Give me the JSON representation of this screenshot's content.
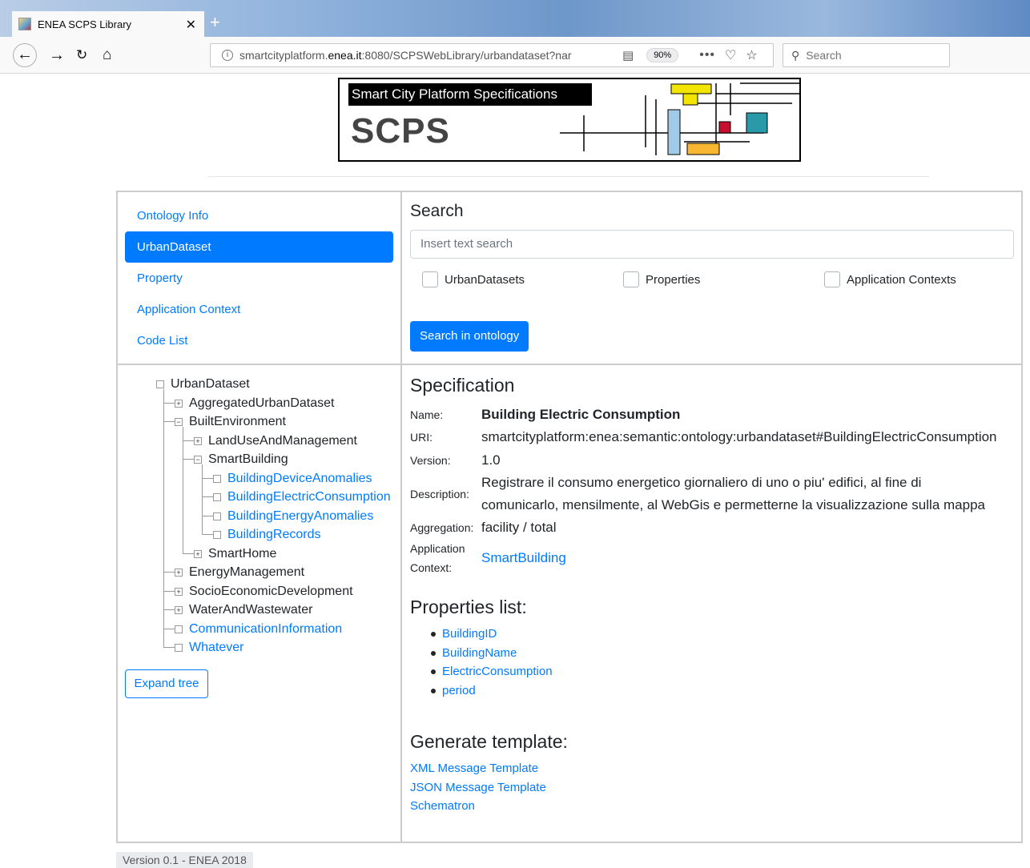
{
  "browser": {
    "tab_title": "ENEA SCPS Library",
    "url_plain": "smartcityplatform.",
    "url_bold": "enea.it",
    "url_rest": ":8080/SCPSWebLibrary/urbandataset?nar",
    "zoom": "90%",
    "search_placeholder": "Search",
    "icons": [
      "back-icon",
      "forward-icon",
      "reload-icon",
      "home-icon",
      "info-icon",
      "reader-icon",
      "more-icon",
      "pocket-icon",
      "star-icon",
      "search-icon",
      "close-icon",
      "new-tab-icon"
    ]
  },
  "logo": {
    "banner": "Smart City Platform Specifications",
    "acronym": "SCPS",
    "colors": {
      "yellow": "#f2e500",
      "blue": "#9fcbe8",
      "orange": "#f7b733",
      "red": "#c8102e",
      "teal": "#2a9aa8"
    }
  },
  "nav": {
    "items": [
      {
        "label": "Ontology Info",
        "active": false
      },
      {
        "label": "UrbanDataset",
        "active": true
      },
      {
        "label": "Property",
        "active": false
      },
      {
        "label": "Application Context",
        "active": false
      },
      {
        "label": "Code List",
        "active": false
      }
    ]
  },
  "search": {
    "title": "Search",
    "placeholder": "Insert text search",
    "checkboxes": [
      "UrbanDatasets",
      "Properties",
      "Application Contexts"
    ],
    "button": "Search in ontology"
  },
  "tree": {
    "nodes": [
      {
        "label": "UrbanDataset",
        "state": "leaf",
        "link": false
      },
      {
        "label": "AggregatedUrbanDataset",
        "state": "collapsed",
        "link": false
      },
      {
        "label": "BuiltEnvironment",
        "state": "expanded",
        "link": false
      },
      {
        "label": "LandUseAndManagement",
        "state": "collapsed",
        "link": false
      },
      {
        "label": "SmartBuilding",
        "state": "expanded",
        "link": false
      },
      {
        "label": "BuildingDeviceAnomalies",
        "state": "leaf",
        "link": true
      },
      {
        "label": "BuildingElectricConsumption",
        "state": "leaf",
        "link": true
      },
      {
        "label": "BuildingEnergyAnomalies",
        "state": "leaf",
        "link": true
      },
      {
        "label": "BuildingRecords",
        "state": "leaf",
        "link": true
      },
      {
        "label": "SmartHome",
        "state": "collapsed",
        "link": false
      },
      {
        "label": "EnergyManagement",
        "state": "collapsed",
        "link": false
      },
      {
        "label": "SocioEconomicDevelopment",
        "state": "collapsed",
        "link": false
      },
      {
        "label": "WaterAndWastewater",
        "state": "collapsed",
        "link": false
      },
      {
        "label": "CommunicationInformation",
        "state": "leaf",
        "link": true
      },
      {
        "label": "Whatever",
        "state": "leaf",
        "link": true
      }
    ],
    "expand_button": "Expand tree"
  },
  "spec": {
    "title": "Specification",
    "name_label": "Name:",
    "name": "Building Electric Consumption",
    "uri_label": "URI:",
    "uri": "smartcityplatform:enea:semantic:ontology:urbandataset#BuildingElectricConsumption",
    "version_label": "Version:",
    "version": "1.0",
    "description_label": "Description:",
    "description_line1": "Registrare il consumo energetico giornaliero di uno o piu' edifici, al fine di",
    "description_line2": "comunicarlo, mensilmente, al WebGis e permetterne la visualizzazione sulla mappa",
    "aggregation_label": "Aggregation:",
    "aggregation": "facility / total",
    "app_context_label_1": "Application",
    "app_context_label_2": "Context:",
    "app_context": "SmartBuilding"
  },
  "properties": {
    "title": "Properties list:",
    "items": [
      "BuildingID",
      "BuildingName",
      "ElectricConsumption",
      "period"
    ]
  },
  "generate": {
    "title": "Generate template:",
    "links": [
      "XML Message Template",
      "JSON Message Template",
      "Schematron"
    ]
  },
  "footer": "Version 0.1 - ENEA 2018"
}
